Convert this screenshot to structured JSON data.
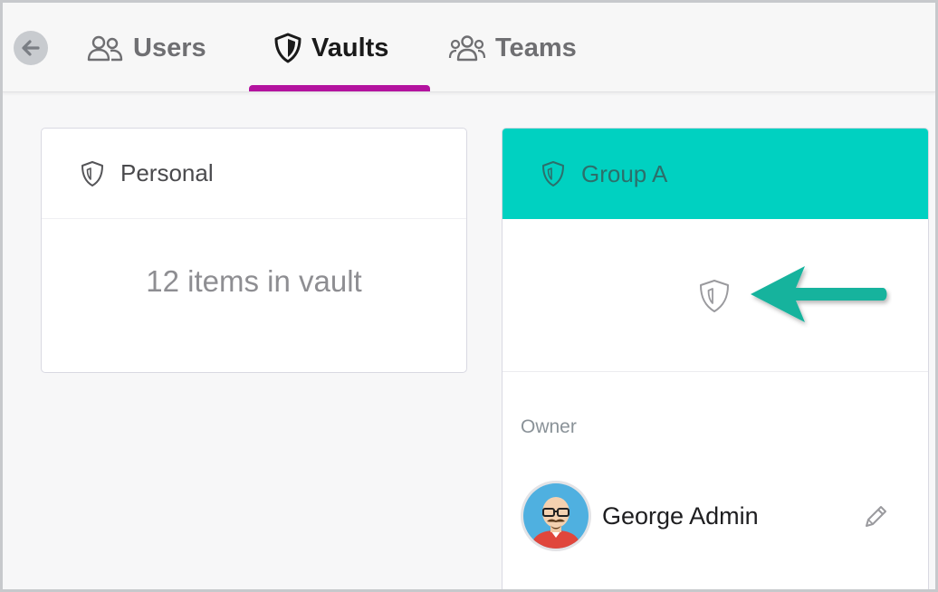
{
  "nav": {
    "tabs": [
      {
        "label": "Users",
        "icon": "users-icon"
      },
      {
        "label": "Vaults",
        "icon": "shield-icon",
        "active": true
      },
      {
        "label": "Teams",
        "icon": "team-icon"
      }
    ],
    "active_color": "#b3139f"
  },
  "vaults": [
    {
      "name": "Personal",
      "summary": "12 items in vault"
    },
    {
      "name": "Group A",
      "header_color": "#00d1c1",
      "owner_label": "Owner",
      "owner_name": "George Admin"
    }
  ],
  "annotation": {
    "arrow_color": "#16b39d"
  }
}
